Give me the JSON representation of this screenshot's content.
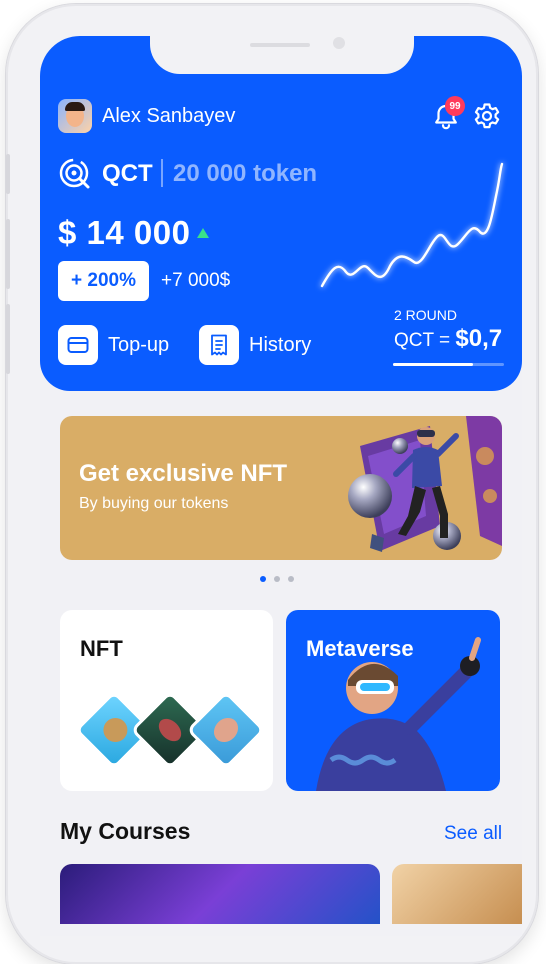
{
  "header": {
    "user_name": "Alex Sanbayev",
    "notification_count": "99"
  },
  "token": {
    "symbol": "QCT",
    "amount": "20 000 token"
  },
  "balance": {
    "value": "$ 14 000",
    "change_percent": "+ 200%",
    "change_amount": "+7 000$"
  },
  "actions": {
    "topup_label": "Top-up",
    "history_label": "History"
  },
  "round": {
    "label": "2 ROUND",
    "rate_prefix": "QCT = ",
    "rate_value": "$0,7",
    "progress": 0.72
  },
  "banner": {
    "title": "Get exclusive NFT",
    "subtitle": "By buying our tokens"
  },
  "carousel": {
    "count": 3,
    "active": 0
  },
  "cards": {
    "nft_title": "NFT",
    "metaverse_title": "Metaverse"
  },
  "courses": {
    "title": "My Courses",
    "see_all": "See all"
  },
  "colors": {
    "primary": "#0a5cff",
    "banner": "#d9ad66",
    "badge": "#ff3b5c"
  }
}
